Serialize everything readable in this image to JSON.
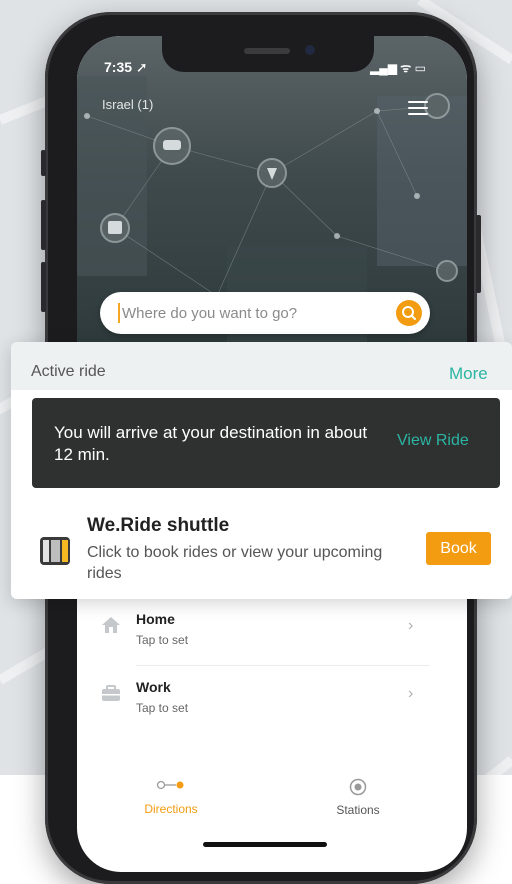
{
  "status": {
    "time": "7:35 ➚",
    "indicators": "▂▄▆ ᯤ ▭"
  },
  "header": {
    "region": "Israel (1)"
  },
  "search": {
    "placeholder": "Where do you want to go?"
  },
  "active_ride": {
    "title": "Active ride",
    "more_label": "More",
    "message": "You will arrive at your destination in about 12 min.",
    "view_label": "View Ride"
  },
  "shuttle": {
    "title": "We.Ride shuttle",
    "subtitle": "Click to book rides or view your upcoming rides",
    "book_label": "Book"
  },
  "favorites": [
    {
      "title": "Home",
      "subtitle": "Tap to set",
      "icon": "home-icon"
    },
    {
      "title": "Work",
      "subtitle": "Tap to set",
      "icon": "briefcase-icon"
    }
  ],
  "tabs": [
    {
      "label": "Directions",
      "icon": "route-icon",
      "active": true
    },
    {
      "label": "Stations",
      "icon": "station-icon",
      "active": false
    }
  ],
  "colors": {
    "accent": "#f39c12",
    "teal": "#2bb5a3",
    "dark": "#2f3030"
  }
}
